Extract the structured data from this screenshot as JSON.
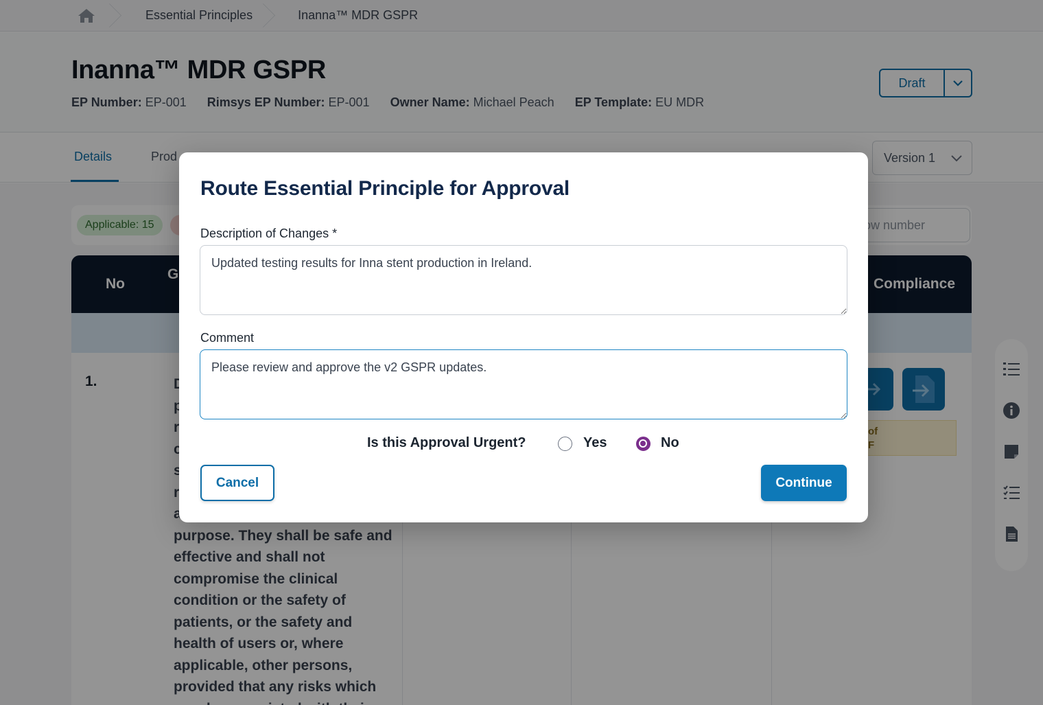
{
  "breadcrumb": {
    "home_icon": "home-icon",
    "items": [
      "Essential Principles",
      "Inanna™ MDR GSPR"
    ]
  },
  "header": {
    "title": "Inanna™ MDR GSPR",
    "meta": [
      {
        "label": "EP Number:",
        "value": "EP-001"
      },
      {
        "label": "Rimsys EP Number:",
        "value": "EP-001"
      },
      {
        "label": "Owner Name:",
        "value": "Michael Peach"
      },
      {
        "label": "EP Template:",
        "value": "EU MDR"
      }
    ],
    "status": "Draft"
  },
  "tabs": {
    "active": "Details",
    "items": [
      "Details",
      "Prod"
    ],
    "version": "Version 1"
  },
  "filters": {
    "applicable": "Applicable: 15",
    "search_placeholder": "y row number"
  },
  "table": {
    "headers": {
      "no": "No",
      "g": "G",
      "compliance": "Compliance"
    },
    "row": {
      "no": "1.",
      "text_visible": "purpose. They shall be safe and effective and shall not compromise the clinical condition or the safety of patients, or the safety and health of users or, where applicable, other persons, provided that any risks which may be associated with their",
      "letters": [
        "D",
        "p",
        "r",
        "c",
        "s",
        "r",
        "a"
      ],
      "note": [
        "of",
        "F"
      ]
    }
  },
  "modal": {
    "title": "Route Essential Principle for Approval",
    "description_label": "Description of Changes *",
    "description_value": "Updated testing results for Inna stent production in Ireland.",
    "comment_label": "Comment",
    "comment_value": "Please review and approve the v2 GSPR updates.",
    "urgent_question": "Is this Approval Urgent?",
    "yes_label": "Yes",
    "no_label": "No",
    "urgent_selected": "No",
    "cancel_label": "Cancel",
    "continue_label": "Continue"
  },
  "colors": {
    "primary": "#0e6ea8",
    "title": "#13294b",
    "radio_selected": "#7b2f8c",
    "table_header": "#0d1b2e"
  }
}
